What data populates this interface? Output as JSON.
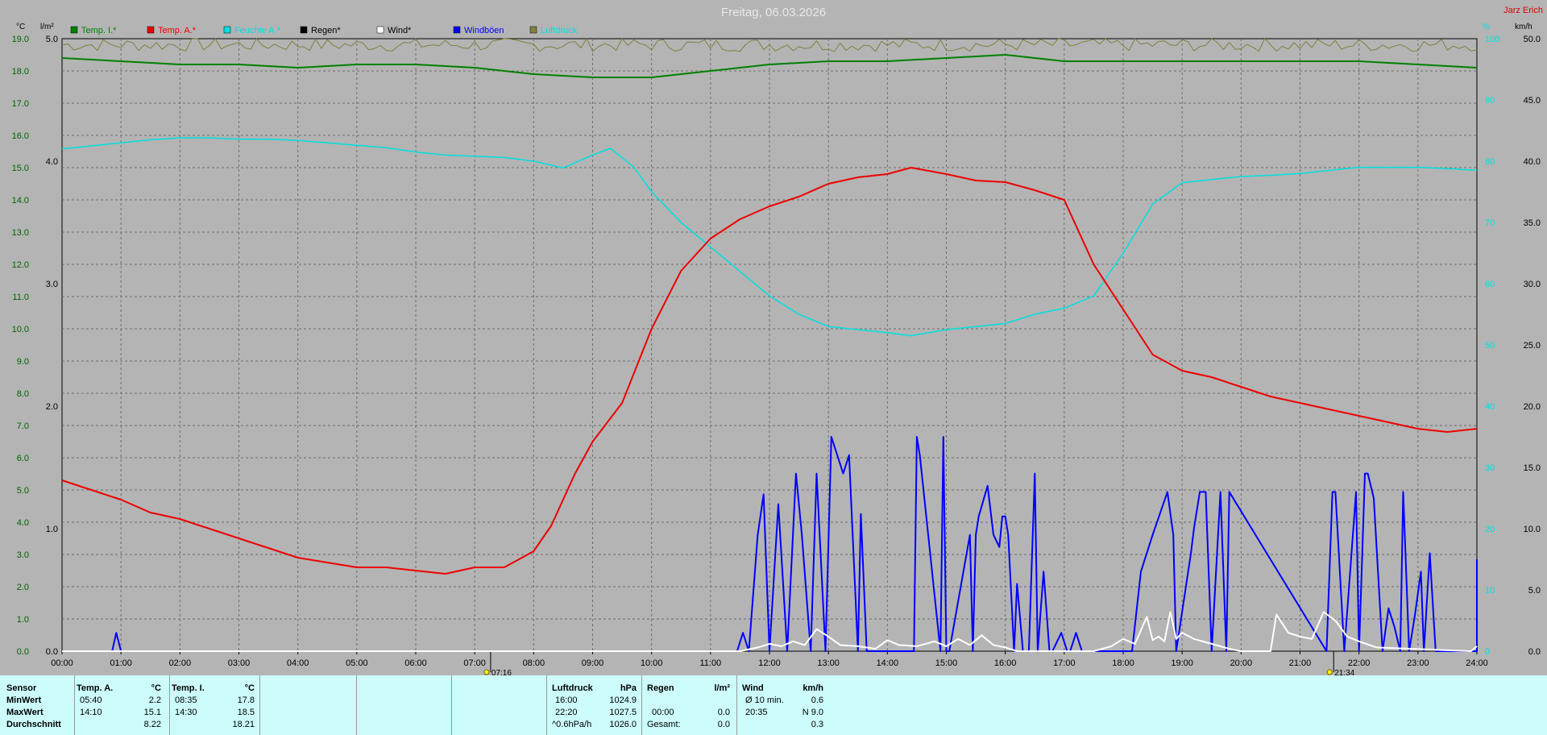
{
  "header": {
    "title": "Freitag, 06.03.2026",
    "author": "Jarz Erich"
  },
  "chart_data": {
    "type": "line",
    "x_range": [
      0,
      24
    ],
    "x_ticks": [
      "00:00",
      "01:00",
      "02:00",
      "03:00",
      "04:00",
      "05:00",
      "06:00",
      "07:00",
      "08:00",
      "09:00",
      "10:00",
      "11:00",
      "12:00",
      "13:00",
      "14:00",
      "15:00",
      "16:00",
      "17:00",
      "18:00",
      "19:00",
      "20:00",
      "21:00",
      "22:00",
      "23:00",
      "24:00"
    ],
    "y_left_temp": {
      "unit": "°C",
      "range": [
        0,
        19
      ],
      "ticks": [
        "0.0",
        "1.0",
        "2.0",
        "3.0",
        "4.0",
        "5.0",
        "6.0",
        "7.0",
        "8.0",
        "9.0",
        "10.0",
        "11.0",
        "12.0",
        "13.0",
        "14.0",
        "15.0",
        "16.0",
        "17.0",
        "18.0",
        "19.0"
      ]
    },
    "y_left_rain": {
      "unit": "l/m²",
      "range": [
        0,
        5
      ],
      "ticks": [
        "0.0",
        "1.0",
        "2.0",
        "3.0",
        "4.0",
        "5.0"
      ]
    },
    "y_right_hum": {
      "unit": "%",
      "range": [
        0,
        100
      ],
      "ticks": [
        "0",
        "10",
        "20",
        "30",
        "40",
        "50",
        "60",
        "70",
        "80",
        "90",
        "100"
      ]
    },
    "y_right_wind": {
      "unit": "km/h",
      "range": [
        0,
        50
      ],
      "ticks": [
        "0.0",
        "5.0",
        "10.0",
        "15.0",
        "20.0",
        "25.0",
        "30.0",
        "35.0",
        "40.0",
        "45.0",
        "50.0"
      ]
    },
    "legend": [
      {
        "label": "Temp. I.*",
        "color": "#008000"
      },
      {
        "label": "Temp. A.*",
        "color": "#ee0000"
      },
      {
        "label": "Feuchte A.*",
        "color": "#00e0e0"
      },
      {
        "label": "Regen*",
        "color": "#000000"
      },
      {
        "label": "Wind*",
        "color": "#ffffff"
      },
      {
        "label": "Windböen",
        "color": "#0000ff"
      },
      {
        "label": "Luftdruck",
        "color": "#808040"
      }
    ],
    "markers": [
      {
        "label": "07:16",
        "x": 7.27
      },
      {
        "label": "21:34",
        "x": 21.57
      }
    ],
    "series": {
      "temp_in": {
        "axis": "temp",
        "color": "#008000",
        "width": 2,
        "x": [
          0,
          1,
          2,
          3,
          4,
          5,
          6,
          7,
          8,
          9,
          10,
          11,
          12,
          13,
          14,
          15,
          16,
          17,
          18,
          19,
          20,
          21,
          22,
          23,
          24
        ],
        "y": [
          18.4,
          18.3,
          18.2,
          18.2,
          18.1,
          18.2,
          18.2,
          18.1,
          17.9,
          17.8,
          17.8,
          18.0,
          18.2,
          18.3,
          18.3,
          18.4,
          18.5,
          18.3,
          18.3,
          18.3,
          18.3,
          18.3,
          18.3,
          18.2,
          18.1
        ]
      },
      "temp_out": {
        "axis": "temp",
        "color": "#ee0000",
        "width": 2,
        "x": [
          0,
          0.5,
          1,
          1.5,
          2,
          2.5,
          3,
          3.5,
          4,
          4.5,
          5,
          5.5,
          6,
          6.5,
          7,
          7.5,
          8,
          8.3,
          8.7,
          9,
          9.5,
          10,
          10.5,
          11,
          11.5,
          12,
          12.5,
          13,
          13.5,
          14,
          14.4,
          15,
          15.5,
          16,
          16.5,
          17,
          17.5,
          18,
          18.5,
          19,
          19.5,
          20,
          20.5,
          21,
          21.5,
          22,
          22.5,
          23,
          23.5,
          24
        ],
        "y": [
          5.3,
          5.0,
          4.7,
          4.3,
          4.1,
          3.8,
          3.5,
          3.2,
          2.9,
          2.75,
          2.6,
          2.6,
          2.5,
          2.4,
          2.6,
          2.6,
          3.1,
          3.9,
          5.5,
          6.5,
          7.7,
          10.0,
          11.8,
          12.8,
          13.4,
          13.8,
          14.1,
          14.5,
          14.7,
          14.8,
          15.0,
          14.8,
          14.6,
          14.55,
          14.3,
          14.0,
          12.0,
          10.6,
          9.2,
          8.7,
          8.5,
          8.2,
          7.9,
          7.7,
          7.5,
          7.3,
          7.1,
          6.9,
          6.8,
          6.9
        ]
      },
      "humidity": {
        "axis": "hum",
        "color": "#00e0e0",
        "width": 1.5,
        "x": [
          0,
          0.5,
          1,
          1.5,
          2,
          2.5,
          3,
          3.5,
          4,
          4.5,
          5,
          5.5,
          6,
          6.5,
          7,
          7.5,
          8,
          8.5,
          9,
          9.3,
          9.7,
          10,
          10.5,
          11,
          11.5,
          12,
          12.5,
          13,
          13.5,
          14,
          14.4,
          15,
          15.5,
          16,
          16.5,
          17,
          17.5,
          18,
          18.5,
          19,
          19.5,
          20,
          20.5,
          21,
          21.5,
          22,
          22.5,
          23,
          23.5,
          24
        ],
        "y": [
          82,
          82.5,
          83,
          83.5,
          83.8,
          83.8,
          83.6,
          83.6,
          83.4,
          83,
          82.6,
          82.2,
          81.5,
          81,
          80.8,
          80.6,
          80,
          78.9,
          81,
          82.1,
          79,
          75,
          70,
          66,
          62,
          58,
          55,
          53,
          52.5,
          52,
          51.5,
          52.5,
          53,
          53.5,
          55,
          56,
          58,
          65,
          73,
          76.5,
          77,
          77.5,
          77.7,
          78,
          78.5,
          79,
          79,
          79,
          78.8,
          78.5
        ]
      },
      "wind": {
        "axis": "wind",
        "color": "#ffffff",
        "width": 2,
        "x": [
          0,
          11.5,
          11.8,
          12,
          12.2,
          12.4,
          12.6,
          12.8,
          13,
          13.2,
          13.5,
          13.8,
          14,
          14.2,
          14.5,
          14.8,
          15,
          15.2,
          15.4,
          15.6,
          15.8,
          16,
          16.2,
          17.5,
          17.8,
          18,
          18.2,
          18.4,
          18.5,
          18.6,
          18.7,
          18.8,
          18.9,
          19,
          19.2,
          19.5,
          19.8,
          20,
          20.5,
          20.6,
          20.8,
          21,
          21.2,
          21.4,
          21.6,
          21.8,
          22,
          22.3,
          23.9,
          24
        ],
        "y": [
          0,
          0,
          0.3,
          0.6,
          0.4,
          0.8,
          0.5,
          1.8,
          1.2,
          0.5,
          0.4,
          0.2,
          0.9,
          0.5,
          0.4,
          0.8,
          0.4,
          1.0,
          0.5,
          1.3,
          0.5,
          0.3,
          0,
          0,
          0.4,
          1.0,
          0.6,
          2.8,
          0.9,
          1.2,
          0.8,
          3.2,
          1.0,
          1.5,
          1.0,
          0.6,
          0.2,
          0,
          0,
          3.0,
          1.5,
          1.2,
          1.0,
          3.2,
          2.5,
          1.2,
          0.8,
          0.3,
          0,
          0.4
        ]
      },
      "gusts": {
        "axis": "wind",
        "color": "#0000ff",
        "width": 2,
        "x": [
          0,
          0.85,
          0.92,
          1.0,
          11.45,
          11.55,
          11.65,
          11.8,
          11.9,
          12.0,
          12.15,
          12.3,
          12.45,
          12.55,
          12.7,
          12.8,
          12.95,
          13.05,
          13.25,
          13.35,
          13.5,
          13.55,
          13.65,
          14.45,
          14.5,
          14.55,
          14.9,
          14.95,
          15.0,
          15.05,
          15.4,
          15.45,
          15.5,
          15.55,
          15.7,
          15.8,
          15.9,
          15.95,
          16.0,
          16.05,
          16.15,
          16.2,
          16.3,
          16.4,
          16.5,
          16.55,
          16.65,
          16.75,
          16.8,
          16.95,
          17.05,
          17.1,
          17.2,
          17.3,
          17.4,
          18.15,
          18.3,
          18.5,
          18.75,
          18.85,
          18.9,
          19.15,
          19.2,
          19.3,
          19.4,
          19.5,
          19.65,
          19.75,
          19.8,
          21.45,
          21.55,
          21.6,
          21.75,
          21.95,
          22.0,
          22.1,
          22.15,
          22.25,
          22.4,
          22.5,
          22.6,
          22.7,
          22.75,
          22.85,
          22.95,
          23.05,
          23.1,
          23.2,
          23.3,
          23.35,
          23.45,
          24.0,
          24.0
        ],
        "y": [
          0,
          0,
          1.5,
          0,
          0,
          1.5,
          0,
          9.5,
          12.8,
          0,
          12.0,
          0,
          14.5,
          9.5,
          0,
          14.5,
          0,
          17.5,
          14.5,
          16.0,
          0,
          11.2,
          0,
          0,
          17.5,
          16.0,
          0,
          17.5,
          0,
          0,
          9.5,
          0,
          9.5,
          11.0,
          13.5,
          9.5,
          8.5,
          11.0,
          11.0,
          9.5,
          0,
          5.5,
          0,
          0,
          14.5,
          0,
          6.5,
          0,
          0,
          1.5,
          0,
          0,
          1.5,
          0,
          0,
          0,
          6.5,
          9.5,
          13.0,
          9.5,
          0,
          8.0,
          10.0,
          13.0,
          13.0,
          0,
          13.0,
          0,
          13.0,
          0,
          13.0,
          13.0,
          0,
          13.0,
          0,
          14.5,
          14.5,
          12.5,
          0,
          3.5,
          2.0,
          0,
          13.0,
          0,
          3.0,
          6.5,
          0,
          8.0,
          0,
          0,
          0,
          0,
          7.5
        ]
      },
      "pressure": {
        "axis": "hum",
        "color": "#808040",
        "width": 1,
        "noise": true,
        "x": [
          0,
          24
        ],
        "y": [
          99,
          99
        ]
      }
    }
  },
  "table": {
    "sensor": {
      "head": "Sensor",
      "rows": [
        "MinWert",
        "MaxWert",
        "Durchschnitt"
      ]
    },
    "temp_a": {
      "head": "Temp. A.",
      "unit": "°C",
      "rows": [
        [
          "05:40",
          "2.2"
        ],
        [
          "14:10",
          "15.1"
        ],
        [
          "",
          "8.22"
        ]
      ]
    },
    "temp_i": {
      "head": "Temp. I.",
      "unit": "°C",
      "rows": [
        [
          "08:35",
          "17.8"
        ],
        [
          "14:30",
          "18.5"
        ],
        [
          "",
          "18.21"
        ]
      ]
    },
    "luftdruck": {
      "head": "Luftdruck",
      "unit": "hPa",
      "rows": [
        [
          "16:00",
          "1024.9"
        ],
        [
          "22:20",
          "1027.5"
        ],
        [
          "^0.6hPa/h",
          "1026.0"
        ]
      ]
    },
    "regen": {
      "head": "Regen",
      "unit": "l/m²",
      "rows": [
        [
          "",
          ""
        ],
        [
          "00:00",
          "0.0"
        ],
        [
          "Gesamt:",
          "0.0"
        ]
      ]
    },
    "wind": {
      "head": "Wind",
      "unit": "km/h",
      "rows": [
        [
          "Ø 10 min.",
          "0.6"
        ],
        [
          "20:35",
          "N 9.0"
        ],
        [
          "",
          "0.3"
        ]
      ]
    }
  }
}
